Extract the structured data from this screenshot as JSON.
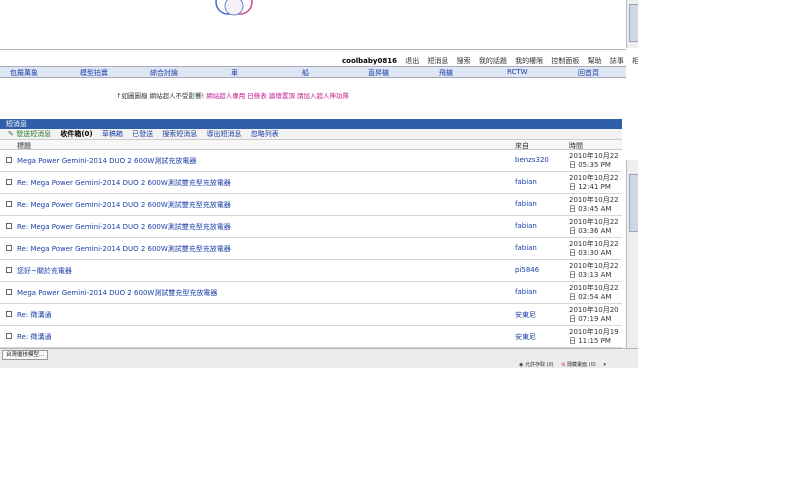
{
  "user_bar": {
    "username": "coolbaby0816",
    "links": [
      "退出",
      "短消息",
      "搜索",
      "我的話題",
      "我的權限",
      "控制面板",
      "幫助",
      "誌事",
      "相簿"
    ]
  },
  "nav": {
    "items": [
      "包羅萬象",
      "模型拍賣",
      "綜合討論",
      "車",
      "船",
      "直昇機",
      "飛機",
      "RCTW",
      "回首頁"
    ]
  },
  "notice": {
    "part1": "↑如圖圖撥 網站超人不受影響!",
    "part2": "網站超人專用 日條表 論壇置頂 請加入超人神功隊"
  },
  "panel": {
    "title": "短消息"
  },
  "tabs": {
    "compose": "發送短消息",
    "inbox": "收件箱(0)",
    "drafts": "草稿箱",
    "sent": "已發送",
    "search": "搜索短消息",
    "export": "導出短消息",
    "ignore": "忽略列表"
  },
  "columns": {
    "subject": "標題",
    "from": "來自",
    "time": "時間"
  },
  "messages": [
    {
      "subject": "Mega Power Gemini-2014 DUO 2 600W測試充放電器",
      "from": "benzs320",
      "date1": "2010年10月22",
      "date2": "日 05:35 PM"
    },
    {
      "subject": "Re: Mega Power Gemini-2014 DUO 2 600W測試雙充型充放電器",
      "from": "fabian",
      "date1": "2010年10月22",
      "date2": "日 12:41 PM"
    },
    {
      "subject": "Re: Mega Power Gemini-2014 DUO 2 600W測試雙充型充放電器",
      "from": "fabian",
      "date1": "2010年10月22",
      "date2": "日 03:45 AM"
    },
    {
      "subject": "Re: Mega Power Gemini-2014 DUO 2 600W測試雙充型充放電器",
      "from": "fabian",
      "date1": "2010年10月22",
      "date2": "日 03:36 AM"
    },
    {
      "subject": "Re: Mega Power Gemini-2014 DUO 2 600W測試雙充型充放電器",
      "from": "fabian",
      "date1": "2010年10月22",
      "date2": "日 03:30 AM"
    },
    {
      "subject": "您好~關於充電器",
      "from": "pi5846",
      "date1": "2010年10月22",
      "date2": "日 03:13 AM"
    },
    {
      "subject": "Mega Power Gemini-2014 DUO 2 600W測試雙充型充放電器",
      "from": "fabian",
      "date1": "2010年10月22",
      "date2": "日 02:54 AM"
    },
    {
      "subject": "Re: 徵溝通",
      "from": "安東尼",
      "date1": "2010年10月20",
      "date2": "日 07:19 AM"
    },
    {
      "subject": "Re: 徵溝通",
      "from": "安東尼",
      "date1": "2010年10月19",
      "date2": "日 11:15 PM"
    }
  ],
  "status_bar": {
    "task": "台灣優技模型...",
    "zone": "允許存取 (0)",
    "blocked": "隱藏畫面 (0)"
  },
  "colors": {
    "header_blue": "#2f5fa8",
    "link_blue": "#1a3fa8",
    "notice_pink": "#c01890"
  }
}
